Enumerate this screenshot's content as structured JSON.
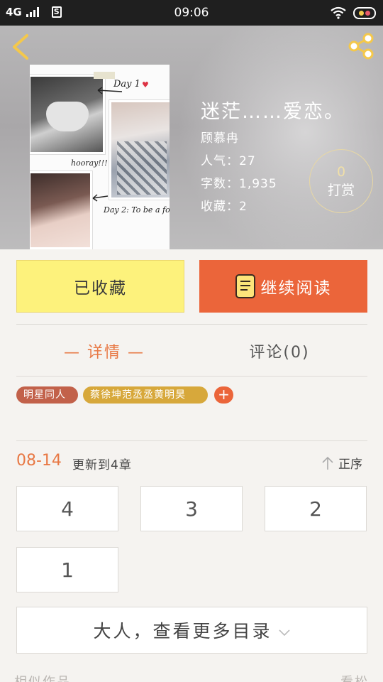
{
  "status_bar": {
    "network": "4G",
    "time": "09:06"
  },
  "book": {
    "title": "迷茫……爱恋。",
    "author": "顾慕冉",
    "popularity_label": "人气：",
    "popularity": "27",
    "word_count_label": "字数：",
    "word_count": "1,935",
    "favorites_label": "收藏：",
    "favorites": "2",
    "tip_count": "0",
    "tip_label": "打赏"
  },
  "cover_text": {
    "day1": "Day 1",
    "hooray": "hooray!!!",
    "day2": "Day 2: To be a fo"
  },
  "actions": {
    "favorited_label": "已收藏",
    "continue_label": "继续阅读"
  },
  "tabs": {
    "details": "— 详情 —",
    "comments": "评论(0)"
  },
  "tags": [
    {
      "label": "明星同人",
      "color": "#c2614a"
    },
    {
      "label": "蔡徐坤范丞丞黄明昊",
      "color": "#d7a83b"
    }
  ],
  "tag_add": "+",
  "update": {
    "date": "08-14",
    "text": "更新到4章",
    "sort_label": "正序"
  },
  "chapters": [
    "4",
    "3",
    "2",
    "1"
  ],
  "more_catalog": "大人，查看更多目录",
  "footer": {
    "left": "相似作品",
    "right": "看松"
  },
  "colors": {
    "accent": "#eb653a",
    "favorite_yellow": "#fdf27c",
    "tag_brown": "#c2614a",
    "tag_gold": "#d7a83b"
  }
}
